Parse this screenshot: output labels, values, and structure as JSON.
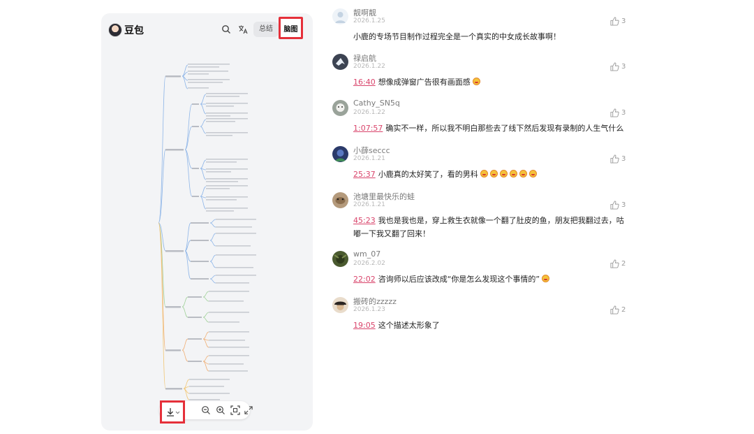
{
  "panel": {
    "brand": "豆包",
    "tabs": {
      "summary": "总结",
      "mindmap": "脑图"
    }
  },
  "icons": {
    "search": "search-icon",
    "translate": "translate-icon",
    "download": "download-icon",
    "zoom_out": "zoom-out-icon",
    "zoom_in": "zoom-in-icon",
    "fit": "fit-screen-icon",
    "fullscreen": "fullscreen-icon",
    "like": "thumbs-up-icon"
  },
  "colors": {
    "highlight": "#e5303a",
    "timestamp": "#d9446b",
    "mindmap_edge": "#8fb6e8"
  },
  "comments": [
    {
      "name": "靓啊靓",
      "date": "2026.1.25",
      "timestamp": "",
      "text": "小鹿的专场节目制作过程完全是一个真实的中女成长故事啊！",
      "emojis": 0,
      "likes": "3"
    },
    {
      "name": "禄启航",
      "date": "2026.1.22",
      "timestamp": "16:40",
      "text": "想像成弹窗广告很有画面感",
      "emojis": 1,
      "likes": "3"
    },
    {
      "name": "Cathy_SN5q",
      "date": "2026.1.22",
      "timestamp": "1:07:57",
      "text": "确实不一样，所以我不明白那些去了线下然后发现有录制的人生气什么",
      "emojis": 0,
      "likes": "3"
    },
    {
      "name": "小薛seccc",
      "date": "2026.1.21",
      "timestamp": "25:37",
      "text": "小鹿真的太好笑了，看的男科",
      "emojis": 6,
      "likes": "3"
    },
    {
      "name": "池塘里最快乐的蛙",
      "date": "2026.1.21",
      "timestamp": "45:23",
      "text": "我也是我也是，穿上救生衣就像一个翻了肚皮的鱼，朋友把我翻过去，咕嘟一下我又翻了回来！",
      "emojis": 0,
      "likes": "3"
    },
    {
      "name": "wm_07",
      "date": "2026.2.02",
      "timestamp": "22:02",
      "text": "咨询师以后应该改成“你是怎么发现这个事情的”",
      "emojis": 1,
      "likes": "2"
    },
    {
      "name": "搬砖的zzzzz",
      "date": "2026.1.23",
      "timestamp": "19:05",
      "text": "这个描述太形象了",
      "emojis": 0,
      "likes": "2"
    }
  ]
}
